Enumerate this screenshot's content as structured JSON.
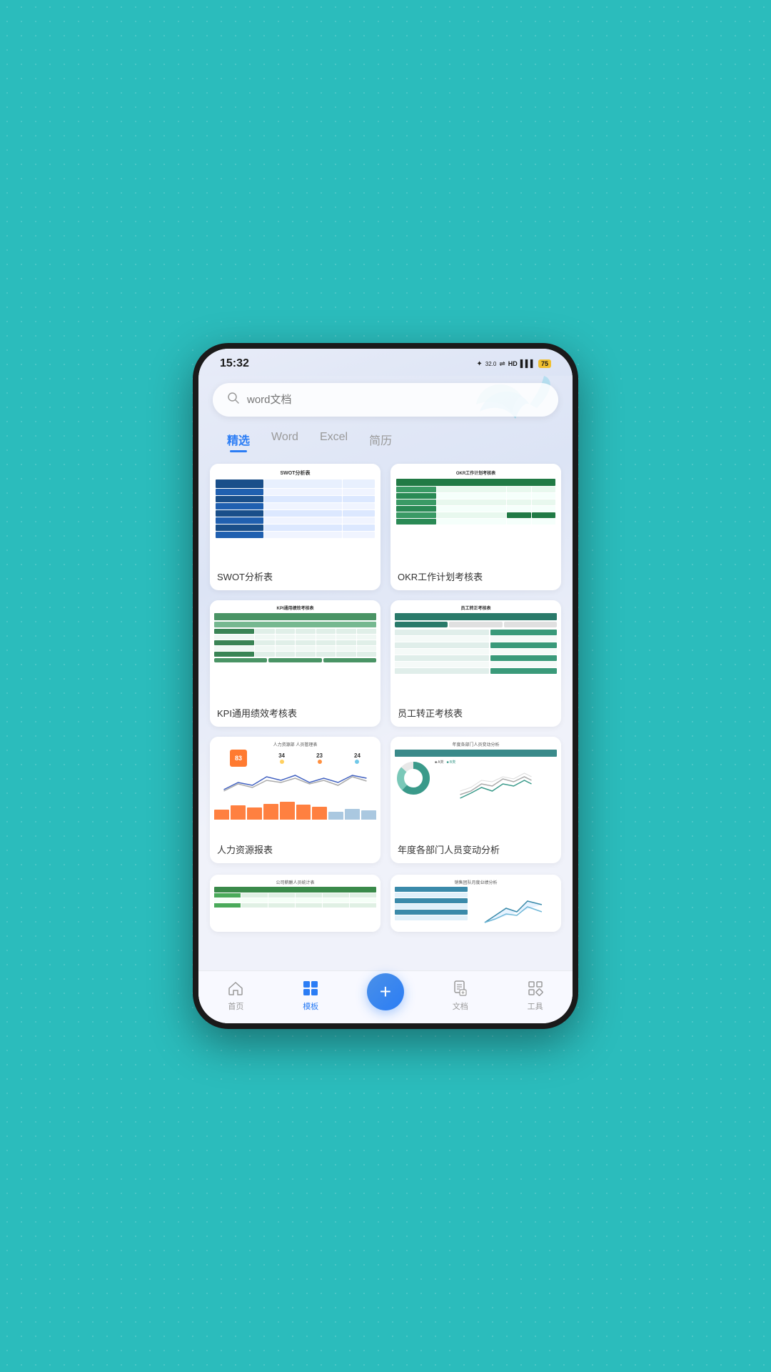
{
  "phone": {
    "statusBar": {
      "time": "15:32",
      "battery": "75",
      "icons": "✦ 32.0 ᵏᵇ/ˢ ⇌ HD"
    }
  },
  "search": {
    "placeholder": "word文档",
    "icon": "🔍"
  },
  "tabs": [
    {
      "id": "featured",
      "label": "精选",
      "active": true
    },
    {
      "id": "word",
      "label": "Word",
      "active": false
    },
    {
      "id": "excel",
      "label": "Excel",
      "active": false
    },
    {
      "id": "resume",
      "label": "简历",
      "active": false
    }
  ],
  "templates": [
    {
      "id": "swot",
      "title": "SWOT分析表",
      "type": "swot"
    },
    {
      "id": "okr",
      "title": "OKR工作计划考核表",
      "type": "okr"
    },
    {
      "id": "kpi",
      "title": "KPI通用绩效考核表",
      "type": "kpi"
    },
    {
      "id": "emp",
      "title": "员工转正考核表",
      "type": "emp"
    },
    {
      "id": "hr",
      "title": "人力资源报表",
      "type": "hr"
    },
    {
      "id": "annual",
      "title": "年度各部门人员变动分析",
      "type": "annual"
    },
    {
      "id": "comp1",
      "title": "",
      "type": "partial1"
    },
    {
      "id": "comp2",
      "title": "",
      "type": "partial2"
    }
  ],
  "bottomNav": {
    "items": [
      {
        "id": "home",
        "label": "首页",
        "active": false,
        "icon": "⌂"
      },
      {
        "id": "template",
        "label": "模板",
        "active": true,
        "icon": "▦"
      },
      {
        "id": "add",
        "label": "+",
        "isAdd": true
      },
      {
        "id": "document",
        "label": "文档",
        "active": false,
        "icon": "☰"
      },
      {
        "id": "tools",
        "label": "工具",
        "active": false,
        "icon": "◈"
      }
    ],
    "addLabel": "+"
  }
}
